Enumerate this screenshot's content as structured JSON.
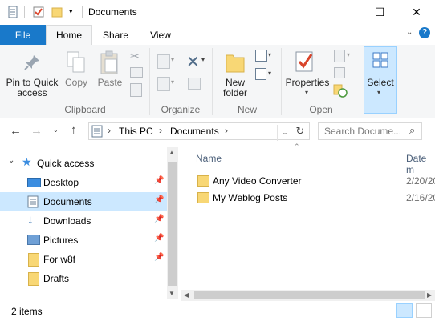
{
  "window": {
    "title": "Documents",
    "minimize": "—",
    "maximize": "☐",
    "close": "✕"
  },
  "ribbon_tabs": {
    "file": "File",
    "home": "Home",
    "share": "Share",
    "view": "View"
  },
  "ribbon": {
    "pin_label": "Pin to Quick access",
    "copy_label": "Copy",
    "paste_label": "Paste",
    "clipboard_group": "Clipboard",
    "organize_group": "Organize",
    "new_folder_label": "New folder",
    "new_group": "New",
    "properties_label": "Properties",
    "open_group": "Open",
    "select_label": "Select"
  },
  "address": {
    "segments": [
      "This PC",
      "Documents"
    ],
    "search_placeholder": "Search Docume..."
  },
  "nav_pane": {
    "quick_access": "Quick access",
    "items": [
      {
        "label": "Desktop",
        "icon": "desktop-icon"
      },
      {
        "label": "Documents",
        "icon": "documents-icon"
      },
      {
        "label": "Downloads",
        "icon": "downloads-icon"
      },
      {
        "label": "Pictures",
        "icon": "pictures-icon"
      },
      {
        "label": "For w8f",
        "icon": "folder-icon"
      },
      {
        "label": "Drafts",
        "icon": "folder-icon"
      }
    ]
  },
  "columns": {
    "name": "Name",
    "date": "Date m"
  },
  "files": [
    {
      "name": "Any Video Converter",
      "date": "2/20/20"
    },
    {
      "name": "My Weblog Posts",
      "date": "2/16/20"
    }
  ],
  "status": {
    "count": "2 items"
  },
  "colors": {
    "file_tab": "#1979ca",
    "selected": "#cce8ff",
    "folder": "#f8d775"
  }
}
